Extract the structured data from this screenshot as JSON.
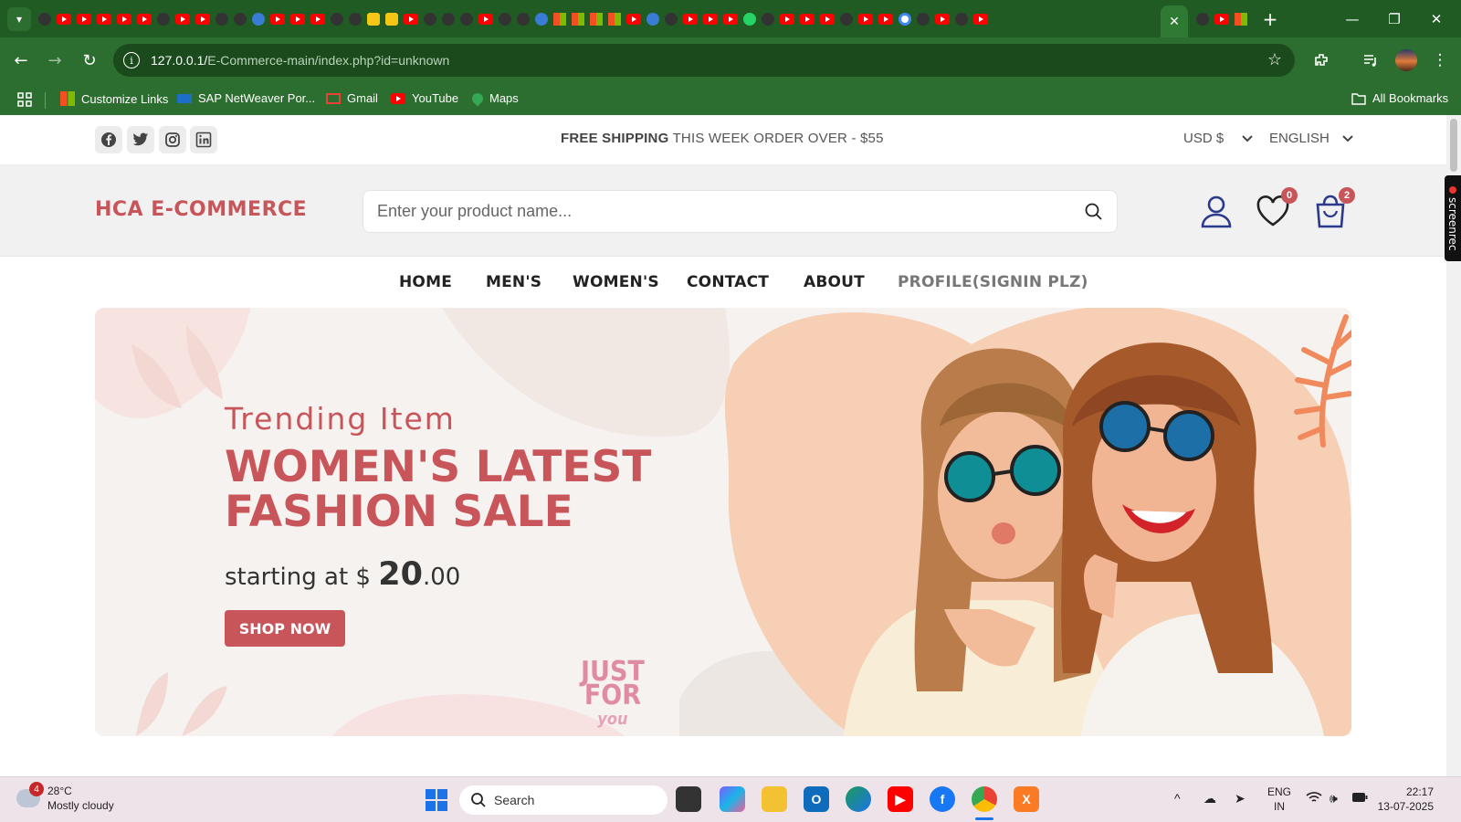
{
  "browser": {
    "url_host": "127.0.0.1/",
    "url_path": "E-Commerce-main/index.php?id=unknown",
    "bookmarks": [
      {
        "label": "Customize Links",
        "icon": "windows-icon"
      },
      {
        "label": "SAP NetWeaver Por...",
        "icon": "sap-icon"
      },
      {
        "label": "Gmail",
        "icon": "gmail-icon"
      },
      {
        "label": "YouTube",
        "icon": "youtube-icon"
      },
      {
        "label": "Maps",
        "icon": "maps-icon"
      }
    ],
    "all_bookmarks": "All Bookmarks"
  },
  "topbar": {
    "shipping_bold": "FREE SHIPPING",
    "shipping_rest": " THIS WEEK ORDER OVER - $55",
    "currency": "USD $",
    "language": "ENGLISH"
  },
  "header": {
    "logo": "HCA E-COMMERCE",
    "search_placeholder": "Enter your product name...",
    "wishlist_count": "0",
    "cart_count": "2"
  },
  "nav": [
    "HOME",
    "MEN'S",
    "WOMEN'S",
    "CONTACT",
    "ABOUT",
    "PROFILE(SIGNIN PLZ)"
  ],
  "banner": {
    "kicker": "Trending Item",
    "title_line1": "WOMEN'S LATEST",
    "title_line2": "FASHION SALE",
    "price_prefix": "starting at $ ",
    "price_big": "20",
    "price_cents": ".00",
    "button": "SHOP NOW",
    "stamp_line1": "JUST",
    "stamp_line2": "FOR",
    "stamp_line3": "you"
  },
  "screenrec": "screenrec",
  "taskbar": {
    "weather_temp": "28°C",
    "weather_desc": "Mostly cloudy",
    "weather_alerts": "4",
    "search": "Search",
    "lang_top": "ENG",
    "lang_bottom": "IN",
    "time": "22:17",
    "date": "13-07-2025"
  },
  "colors": {
    "brand": "#c8555a",
    "chrome_green": "#2c6e2f"
  }
}
